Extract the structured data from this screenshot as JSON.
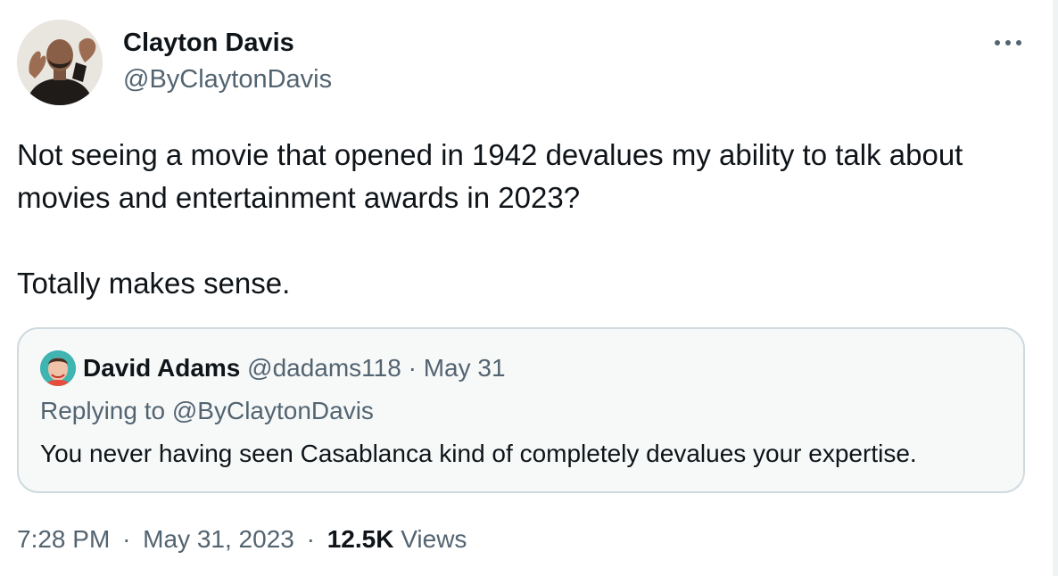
{
  "author": {
    "name": "Clayton Davis",
    "handle": "@ByClaytonDavis"
  },
  "tweet": {
    "line1": "Not seeing a movie that opened in 1942 devalues my ability to talk about",
    "line2": "movies and entertainment awards in 2023?",
    "line3": "Totally makes sense."
  },
  "quoted": {
    "name": "David Adams",
    "handle": "@dadams118",
    "separator": "·",
    "date": "May 31",
    "replying_prefix": "Replying to",
    "replying_to": "@ByClaytonDavis",
    "text": "You never having seen Casablanca kind of completely devalues your expertise."
  },
  "meta": {
    "time": "7:28 PM",
    "separator": "·",
    "date": "May 31, 2023",
    "views_count": "12.5K",
    "views_label": "Views"
  },
  "icons": {
    "more": "more-horizontal-icon"
  },
  "colors": {
    "text_primary": "#0f1419",
    "text_secondary": "#536471",
    "quote_border": "#cfd9de",
    "quote_background": "#f7f9f9"
  }
}
